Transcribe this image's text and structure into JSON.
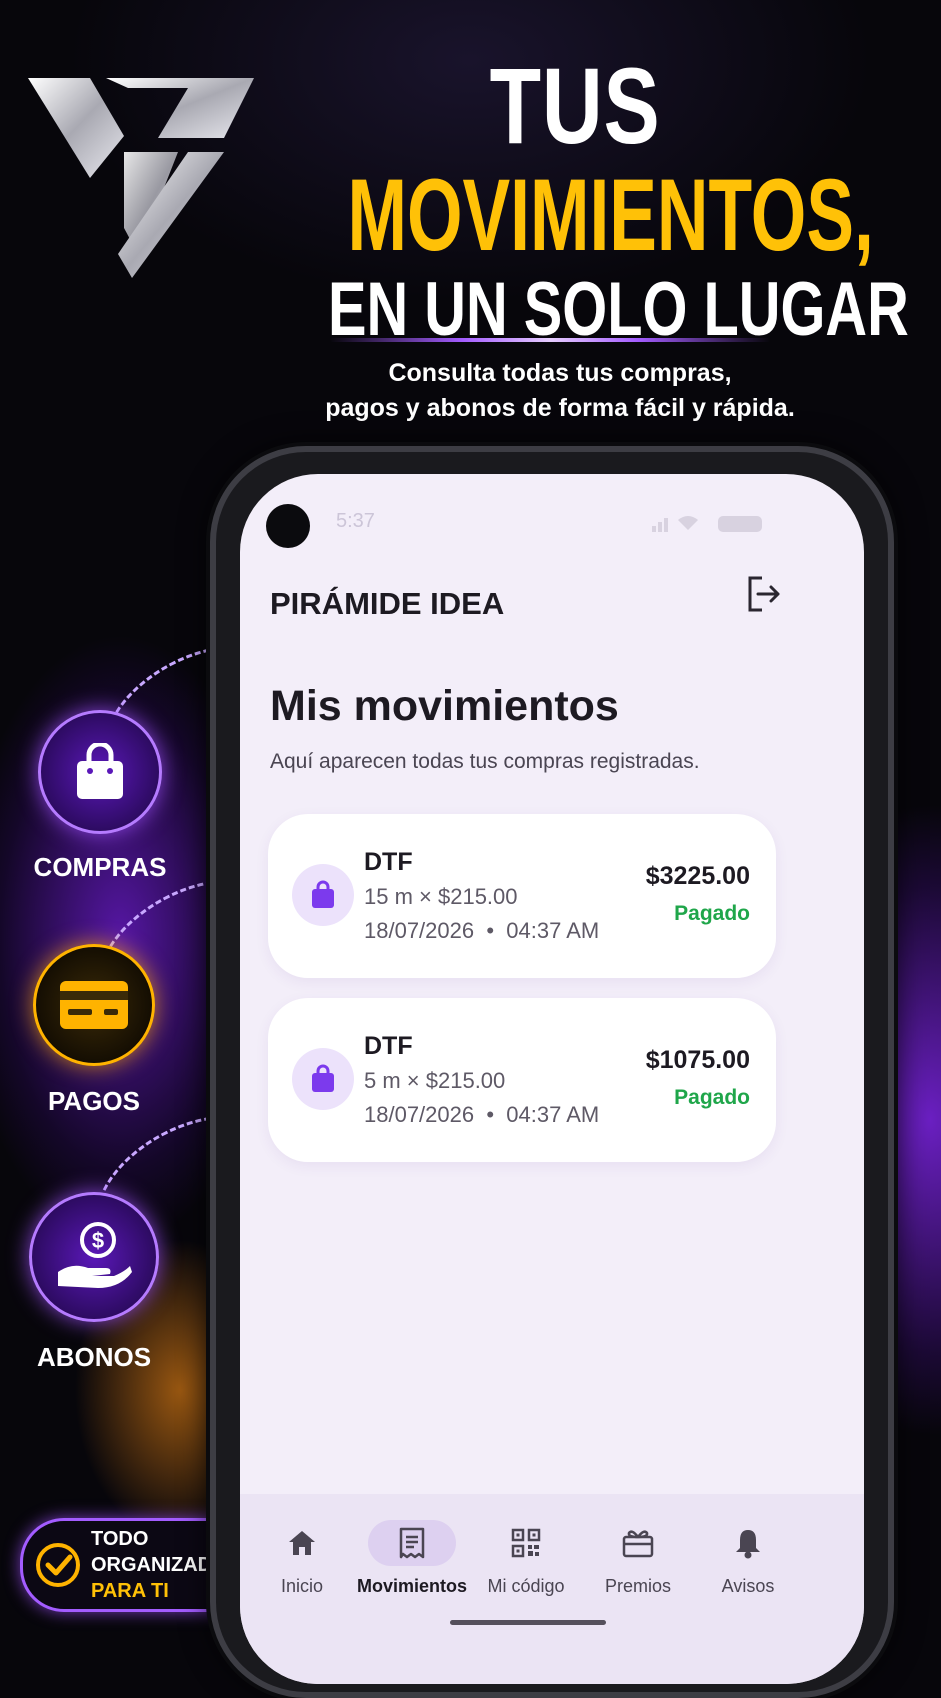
{
  "headline": {
    "line1": "TUS",
    "line2": "MOVIMIENTOS,",
    "line3": "EN UN SOLO LUGAR",
    "subtitle_1": "Consulta todas tus compras,",
    "subtitle_2": "pagos y abonos de forma fácil y rápida."
  },
  "features": [
    {
      "label": "COMPRAS",
      "icon": "shopping-bag-icon"
    },
    {
      "label": "PAGOS",
      "icon": "credit-card-icon"
    },
    {
      "label": "ABONOS",
      "icon": "hand-dollar-icon"
    }
  ],
  "badge": {
    "line1": "TODO ORGANIZADO",
    "line2": "PARA TI"
  },
  "status_bar": {
    "time": "5:37"
  },
  "app": {
    "title": "PIRÁMIDE IDEA",
    "page_title": "Mis movimientos",
    "page_subtitle": "Aquí aparecen todas tus compras registradas."
  },
  "movements": [
    {
      "product": "DTF",
      "detail": "15 m × $215.00",
      "date": "18/07/2026",
      "time": "04:37 AM",
      "amount": "$3225.00",
      "status": "Pagado"
    },
    {
      "product": "DTF",
      "detail": "5 m × $215.00",
      "date": "18/07/2026",
      "time": "04:37 AM",
      "amount": "$1075.00",
      "status": "Pagado"
    }
  ],
  "nav": [
    {
      "label": "Inicio",
      "icon": "home-icon"
    },
    {
      "label": "Movimientos",
      "icon": "receipt-icon",
      "active": true
    },
    {
      "label": "Mi código",
      "icon": "qr-code-icon"
    },
    {
      "label": "Premios",
      "icon": "gift-icon"
    },
    {
      "label": "Avisos",
      "icon": "bell-icon"
    }
  ],
  "colors": {
    "accent": "#ffc107",
    "brand_purple": "#7c3aed",
    "paid_green": "#1fa64a"
  }
}
